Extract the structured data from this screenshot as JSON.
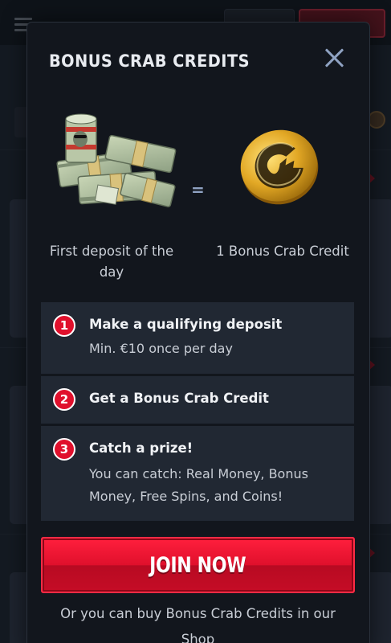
{
  "modal": {
    "title": "BONUS CRAB CREDITS",
    "equals_sign": "=",
    "left_caption": "First deposit of the day",
    "right_caption": "1 Bonus Crab Credit",
    "steps": [
      {
        "number": "1",
        "title": "Make a qualifying deposit",
        "description": "Min. €10 once per day"
      },
      {
        "number": "2",
        "title": "Get a Bonus Crab Credit",
        "description": ""
      },
      {
        "number": "3",
        "title": "Catch a prize!",
        "description": "You can catch: Real Money, Bonus Money, Free Spins, and Coins!"
      }
    ],
    "cta_label": "JOIN NOW",
    "shop_note": "Or you can buy Bonus Crab Credits in our Shop"
  },
  "icons": {
    "close": "close-icon",
    "money": "money-stack-icon",
    "coin": "crab-coin-icon"
  },
  "colors": {
    "accent": "#e0102c",
    "modal_bg": "#12161d",
    "step_bg": "#212833",
    "close": "#8fa2c2"
  }
}
